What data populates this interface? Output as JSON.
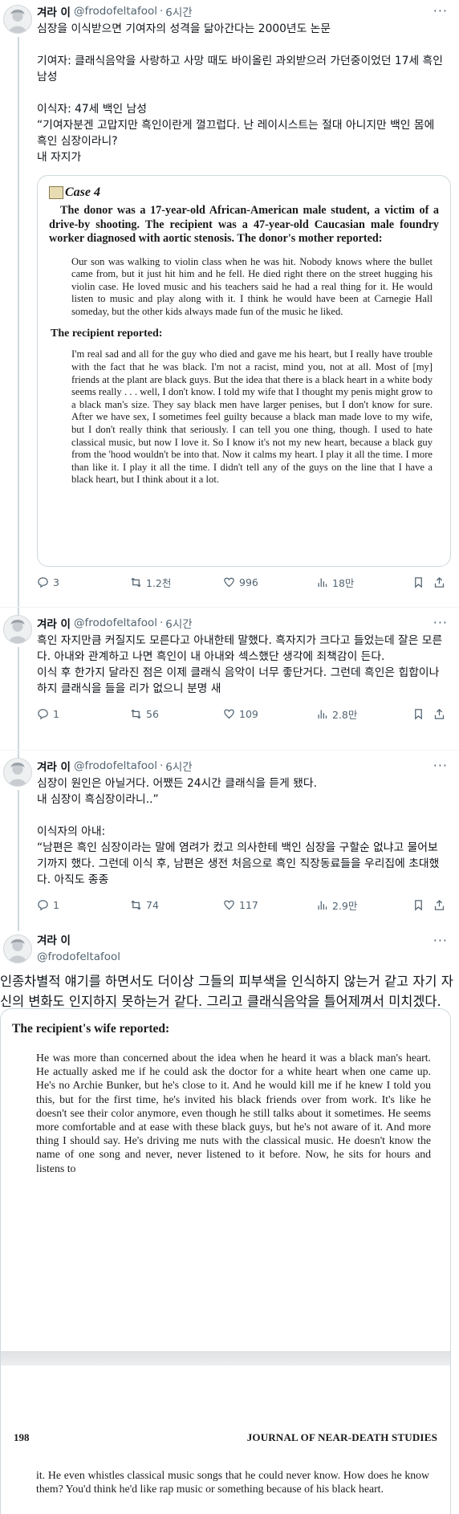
{
  "tweets": [
    {
      "name": "겨라 이",
      "handle": "@frodofeltafool",
      "time": "6시간",
      "text": "심장을 이식받으면 기여자의 성격을 닮아간다는 2000년도 논문\n\n기여자: 클래식음악을 사랑하고 사망 때도 바이올린 과외받으러 가던중이었던 17세 흑인 남성\n\n이식자: 47세 백인 남성\n“기여자분겐 고맙지만 흑인이란게 껄끄럽다. 난 레이시스트는 절대 아니지만 백인 몸에 흑인 심장이라니?\n내 자지가",
      "replies": "3",
      "retweets": "1.2천",
      "likes": "996",
      "views": "18만"
    },
    {
      "name": "겨라 이",
      "handle": "@frodofeltafool",
      "time": "6시간",
      "text": "흑인 자지만큼 커질지도 모른다고 아내한테 말했다. 흑자지가 크다고 들었는데 잘은 모른다. 아내와 관계하고 나면 흑인이 내 아내와 섹스했단 생각에 죄책감이 든다.\n이식 후 한가지 달라진 점은 이제 클래식 음악이 너무 좋단거다. 그런데 흑인은 힙합이나 하지 클래식을 들을 리가 없으니 분명 새",
      "replies": "1",
      "retweets": "56",
      "likes": "109",
      "views": "2.8만"
    },
    {
      "name": "겨라 이",
      "handle": "@frodofeltafool",
      "time": "6시간",
      "text": "심장이 원인은 아닐거다. 어쨌든 24시간 클래식을 듣게 됐다.\n내 심장이 흑심장이라니..”\n\n이식자의 아내:\n“남편은 흑인 심장이라는 말에 염려가 컸고 의사한테 백인 심장을 구할순 없냐고 물어보기까지 했다. 그런데 이식 후, 남편은 생전 처음으로 흑인 직장동료들을 우리집에 초대했다. 아직도 종종",
      "replies": "1",
      "retweets": "74",
      "likes": "117",
      "views": "2.9만"
    },
    {
      "name": "겨라 이",
      "handle": "@frodofeltafool",
      "text": "인종차별적 얘기를 하면서도 더이상 그들의 피부색을 인식하지 않는거 같고 자기 자신의 변화도 인지하지 못하는거 같다. 그리고 클래식음악을 틀어제껴서 미치겠다. 생전 듣지도 않던 사람이 이젠 몇시간씩 앉아 들으며 휘파람까지 분다. 흑심장을 가졌으면 랩을 들을텐데 말이다”"
    }
  ],
  "case_image": {
    "case_label": "Case 4",
    "intro": "The donor was a 17-year-old African-American male student, a victim of a drive-by shooting. The recipient was a 47-year-old Caucasian male foundry worker diagnosed with aortic stenosis. The donor's mother reported:",
    "mother_quote": "Our son was walking to violin class when he was hit. Nobody knows where the bullet came from, but it just hit him and he fell. He died right there on the street hugging his violin case. He loved music and his teachers said he had a real thing for it. He would listen to music and play along with it. I think he would have been at Carnegie Hall someday, but the other kids always made fun of the music he liked.",
    "recipient_heading": "The recipient reported:",
    "recipient_quote": "I'm real sad and all for the guy who died and gave me his heart, but I really have trouble with the fact that he was black. I'm not a racist, mind you, not at all. Most of [my] friends at the plant are black guys. But the idea that there is a black heart in a white body seems really . . . well, I don't know. I told my wife that I thought my penis might grow to a black man's size. They say black men have larger penises, but I don't know for sure. After we have sex, I sometimes feel guilty because a black man made love to my wife, but I don't really think that seriously. I can tell you one thing, though. I used to hate classical music, but now I love it. So I know it's not my new heart, because a black guy from the 'hood wouldn't be into that. Now it calms my heart. I play it all the time. I more than like it. I play it all the time. I didn't tell any of the guys on the line that I have a black heart, but I think about it a lot."
  },
  "wife_image": {
    "heading": "The recipient's wife reported:",
    "quote": "He was more than concerned about the idea when he heard it was a black man's heart. He actually asked me if he could ask the doctor for a white heart when one came up. He's no Archie Bunker, but he's close to it. And he would kill me if he knew I told you this, but for the first time, he's invited his black friends over from work. It's like he doesn't see their color anymore, even though he still talks about it sometimes. He seems more comfortable and at ease with these black guys, but he's not aware of it. And more thing I should say. He's driving me nuts with the classical music. He doesn't know the name of one song and never, never listened to it before. Now, he sits for hours and listens to",
    "page_number": "198",
    "journal": "JOURNAL OF NEAR-DEATH STUDIES",
    "continuation": "it. He even whistles classical music songs that he could never know. How does he know them? You'd think he'd like rap music or something because of his black heart."
  }
}
